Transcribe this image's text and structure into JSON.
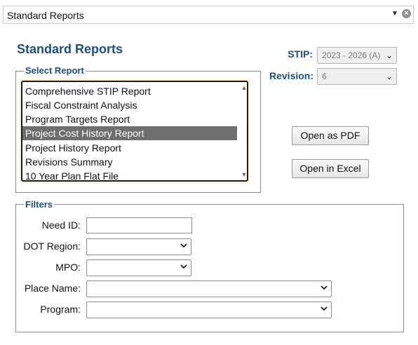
{
  "topbar": {
    "title": "Standard Reports",
    "caret_icon": "caret-down-icon",
    "close_icon": "close-circle-icon"
  },
  "heading": "Standard Reports",
  "select_report": {
    "legend": "Select Report",
    "items": [
      "Comprehensive STIP Report",
      "Fiscal Constraint Analysis",
      "Program Targets Report",
      "Project Cost History Report",
      "Project History Report",
      "Revisions Summary",
      "10 Year Plan Flat File"
    ],
    "selected_index": 3
  },
  "stip": {
    "label": "STIP:",
    "value": "2023 - 2026 (A)"
  },
  "revision": {
    "label": "Revision:",
    "value": "6"
  },
  "buttons": {
    "open_pdf": "Open as PDF",
    "open_excel": "Open in Excel"
  },
  "filters": {
    "legend": "Filters",
    "need_id": {
      "label": "Need ID:",
      "value": ""
    },
    "dot_region": {
      "label": "DOT Region:",
      "value": ""
    },
    "mpo": {
      "label": "MPO:",
      "value": ""
    },
    "place_name": {
      "label": "Place Name:",
      "value": ""
    },
    "program": {
      "label": "Program:",
      "value": ""
    }
  }
}
